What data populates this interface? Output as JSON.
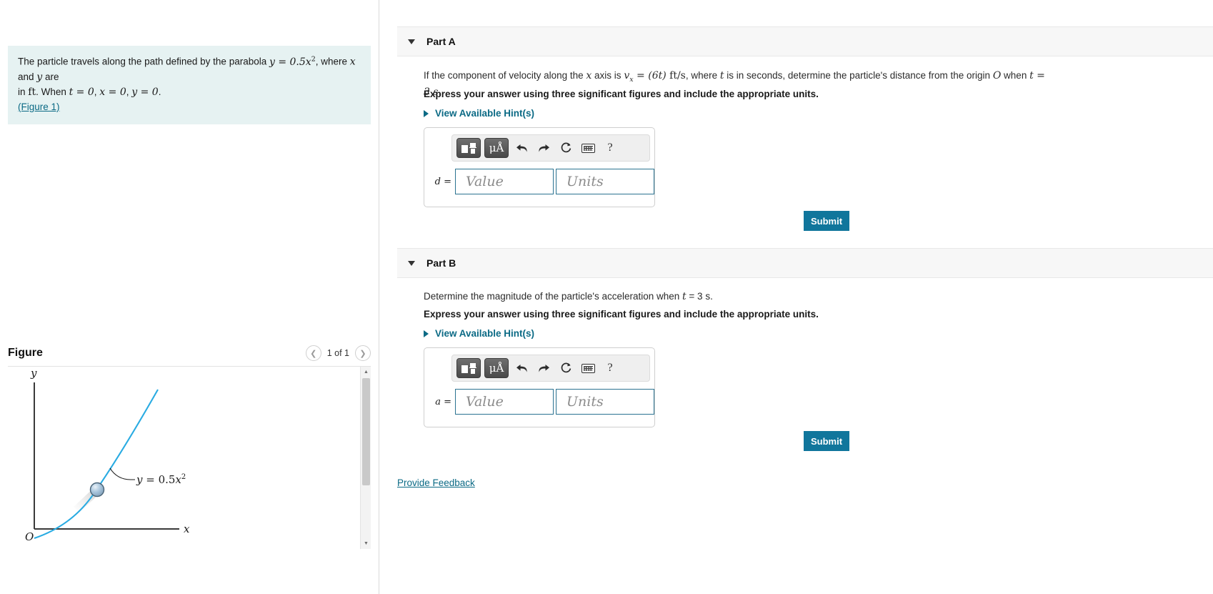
{
  "problem": {
    "line1_pre": "The particle travels along the path defined by the parabola ",
    "eq_y": "y = 0.5x",
    "eq_y_exp": "2",
    "line1_post": ", where ",
    "var_x": "x",
    "and": " and ",
    "var_y": "y",
    "line1_end": " are",
    "line2_pre": "in ",
    "unit_ft": "ft",
    "line2_mid": ". When ",
    "cond_t": "t = 0",
    "cond_x": "x = 0",
    "cond_y": "y = 0",
    "period": ".",
    "figure_link": "(Figure 1)"
  },
  "figure": {
    "title": "Figure",
    "prev_icon": "chevron-left-icon",
    "next_icon": "chevron-right-icon",
    "counter": "1 of 1",
    "axis_y_label": "y",
    "axis_x_label": "x",
    "origin_label": "O",
    "curve_label": "y = 0.5x",
    "curve_label_exp": "2",
    "curve_color": "#29abe2"
  },
  "parts": [
    {
      "id": "part-a",
      "label": "Part A",
      "caret_icon": "caret-down-icon",
      "question_pre": "If the component of velocity along the ",
      "question_x": "x",
      "question_mid": " axis is ",
      "question_v": "v",
      "question_v_sub": "x",
      "question_eq": " = (6t)",
      "question_units": " ft/s",
      "question_post": ", where ",
      "question_t": "t",
      "question_tail": " is in seconds, determine the particle's distance from the origin ",
      "question_O": "O",
      "question_when": " when ",
      "question_time": "t = 3 s.",
      "instruction": "Express your answer using three significant figures and include the appropriate units.",
      "hints_label": "View Available Hint(s)",
      "hints_caret_icon": "caret-right-icon",
      "variable": "d =",
      "value_placeholder": "Value",
      "units_placeholder": "Units",
      "value_current": "",
      "units_current": "",
      "submit_label": "Submit",
      "toolbar": {
        "template_icon": "math-template-icon",
        "units_icon": "greek-units-icon",
        "units_glyph": "μÅ",
        "undo_icon": "undo-arrow-icon",
        "redo_icon": "redo-arrow-icon",
        "reset_icon": "reset-circular-arrow-icon",
        "keyboard_icon": "keyboard-icon",
        "help_icon": "question-mark-icon",
        "help_glyph": "?"
      }
    },
    {
      "id": "part-b",
      "label": "Part B",
      "caret_icon": "caret-down-icon",
      "question_pre": "Determine the magnitude of the particle's acceleration when ",
      "question_x": "",
      "question_mid": "",
      "question_v": "",
      "question_v_sub": "",
      "question_eq": "",
      "question_units": "",
      "question_post": "",
      "question_t": "t",
      "question_tail": "",
      "question_O": "",
      "question_when": "",
      "question_time": " = 3 s.",
      "instruction": "Express your answer using three significant figures and include the appropriate units.",
      "hints_label": "View Available Hint(s)",
      "hints_caret_icon": "caret-right-icon",
      "variable": "a =",
      "value_placeholder": "Value",
      "units_placeholder": "Units",
      "value_current": "",
      "units_current": "",
      "submit_label": "Submit",
      "toolbar": {
        "template_icon": "math-template-icon",
        "units_icon": "greek-units-icon",
        "units_glyph": "μÅ",
        "undo_icon": "undo-arrow-icon",
        "redo_icon": "redo-arrow-icon",
        "reset_icon": "reset-circular-arrow-icon",
        "keyboard_icon": "keyboard-icon",
        "help_icon": "question-mark-icon",
        "help_glyph": "?"
      }
    }
  ],
  "footer": {
    "feedback_label": "Provide Feedback"
  },
  "colors": {
    "accent": "#10769c",
    "link": "#0b6a85",
    "problem_bg": "#e6f2f2",
    "part_header_bg": "#f7f7f7",
    "field_border": "#2b7391"
  }
}
